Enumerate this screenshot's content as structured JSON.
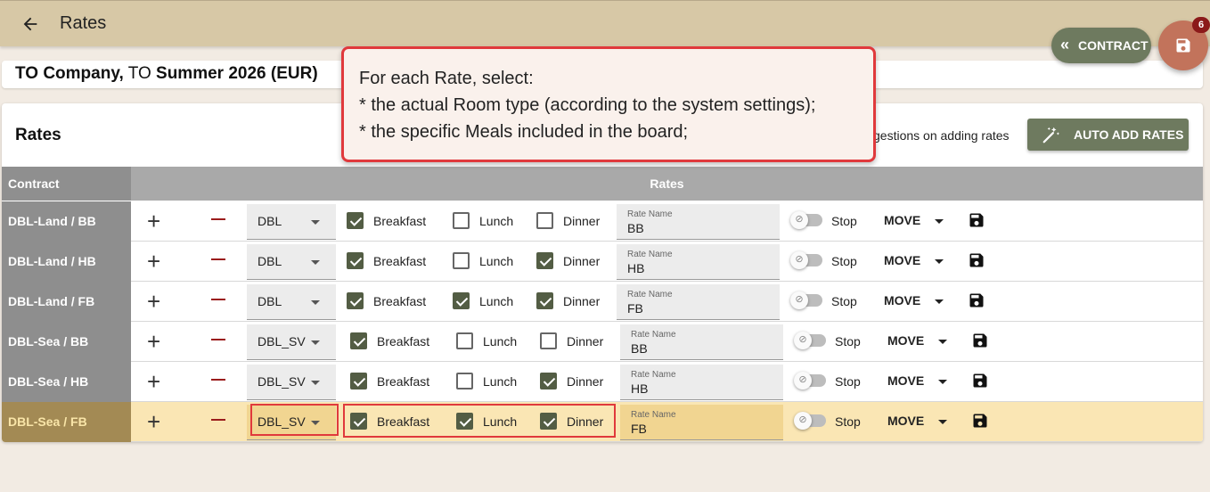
{
  "header": {
    "back_icon": "arrow-left-icon",
    "title": "Rates"
  },
  "contract": {
    "company": "TO Company,",
    "prefix": "TO",
    "name": "Summer 2026 (EUR)"
  },
  "rates_section": {
    "title": "Rates",
    "suggestion_text": "gestions on adding rates",
    "auto_add_label": "AUTO ADD RATES",
    "auto_add_icon": "magic-wand-icon"
  },
  "table": {
    "col_contract": "Contract",
    "col_rates": "Rates",
    "meal_labels": {
      "breakfast": "Breakfast",
      "lunch": "Lunch",
      "dinner": "Dinner"
    },
    "rate_name_label": "Rate Name",
    "stop_label": "Stop",
    "move_label": "MOVE",
    "rows": [
      {
        "contract": "DBL-Land / BB",
        "room": "DBL",
        "breakfast": true,
        "lunch": false,
        "dinner": false,
        "rate_name": "BB",
        "selected": false
      },
      {
        "contract": "DBL-Land / HB",
        "room": "DBL",
        "breakfast": true,
        "lunch": false,
        "dinner": true,
        "rate_name": "HB",
        "selected": false
      },
      {
        "contract": "DBL-Land / FB",
        "room": "DBL",
        "breakfast": true,
        "lunch": true,
        "dinner": true,
        "rate_name": "FB",
        "selected": false
      },
      {
        "contract": "DBL-Sea / BB",
        "room": "DBL_SV",
        "breakfast": true,
        "lunch": false,
        "dinner": false,
        "rate_name": "BB",
        "selected": false
      },
      {
        "contract": "DBL-Sea / HB",
        "room": "DBL_SV",
        "breakfast": true,
        "lunch": false,
        "dinner": true,
        "rate_name": "HB",
        "selected": false
      },
      {
        "contract": "DBL-Sea / FB",
        "room": "DBL_SV",
        "breakfast": true,
        "lunch": true,
        "dinner": true,
        "rate_name": "FB",
        "selected": true
      }
    ]
  },
  "callout": {
    "line1": "For each Rate, select:",
    "line2": "* the actual Room type (according to the system settings);",
    "line3": "* the specific Meals included in the board;"
  },
  "actions": {
    "contract_label": "CONTRACT",
    "save_badge": "6"
  },
  "colors": {
    "header_bg": "#d7c8a6",
    "accent_green": "#6e7a5f",
    "fab": "#c2735b",
    "highlight": "#e0393c"
  }
}
